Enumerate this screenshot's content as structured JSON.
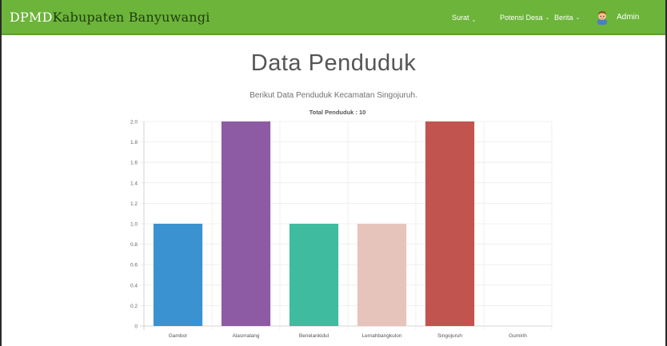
{
  "header": {
    "brand_strong": "DPMD",
    "brand_rest": "Kabupaten Banyuwangi",
    "menu": {
      "surat": "Surat",
      "potensi_desa": "Potensi Desa",
      "berita": "Berita"
    },
    "user": {
      "name": "Admin"
    }
  },
  "main": {
    "title": "Data Penduduk",
    "subtitle": "Berikut Data Penduduk Kecamatan Singojuruh."
  },
  "colors": {
    "navbar": "#6cb43a",
    "brand_strong": "#ffffff",
    "brand_rest": "#1f3d10"
  },
  "icons": {
    "menu_dropdown": "chevron-down-icon",
    "user": "user-avatar-icon"
  },
  "chart_data": {
    "type": "bar",
    "title": "Total Penduduk : 10",
    "categories": [
      "Gambor",
      "Alasmalang",
      "Benelankidul",
      "Lemahbangkulon",
      "Singojuruh",
      "Gumirih"
    ],
    "values": [
      1,
      2,
      1,
      1,
      2,
      0
    ],
    "colors": [
      "#3a93d0",
      "#8d5ba3",
      "#3fbc9f",
      "#e7c4bb",
      "#c2544f",
      "#cccccc"
    ],
    "ylim": [
      0,
      2.0
    ],
    "yticks": [
      "0",
      "0.2",
      "0.4",
      "0.6",
      "0.8",
      "1.0",
      "1.2",
      "1.4",
      "1.6",
      "1.8",
      "2.0"
    ],
    "xlabel": "",
    "ylabel": "",
    "grid": true,
    "legend": "none"
  }
}
